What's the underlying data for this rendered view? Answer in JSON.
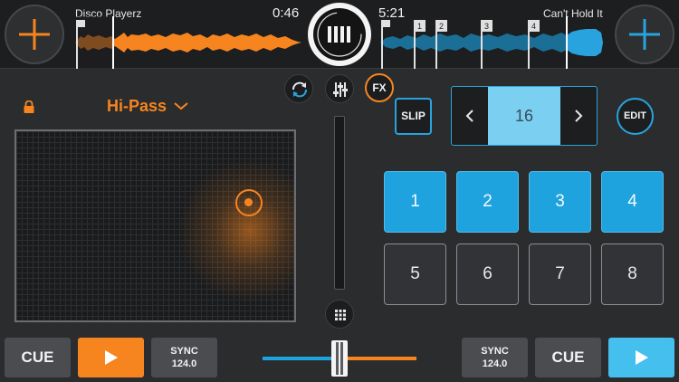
{
  "decks": {
    "left": {
      "track_title": "Disco Playerz",
      "time": "0:46",
      "accent_color": "#f7851f",
      "play_position": 0.12,
      "cue_label": "CUE",
      "sync_label": "SYNC",
      "bpm": "124.0",
      "play_icon": "play-icon"
    },
    "right": {
      "track_title": "Can't Hold It",
      "time": "5:21",
      "accent_color": "#29a3dd",
      "play_position": 0.84,
      "cue_label": "CUE",
      "sync_label": "SYNC",
      "bpm": "124.0",
      "play_icon": "play-icon",
      "hot_cue_markers": [
        "1",
        "2",
        "3",
        "4"
      ]
    }
  },
  "center_controls": {
    "logo_icon": "cross-dj-logo-icon",
    "loop_sync_icon": "loop-arrows-icon",
    "mixer_icon": "sliders-icon",
    "fx_label": "FX",
    "pads_icon": "grid-icon"
  },
  "fx_panel": {
    "lock_icon": "lock-icon",
    "effect_name": "Hi-Pass",
    "dropdown_icon": "chevron-down-icon"
  },
  "loop": {
    "slip_label": "SLIP",
    "prev_icon": "chevron-left-icon",
    "value": "16",
    "next_icon": "chevron-right-icon",
    "edit_label": "EDIT"
  },
  "pads": [
    {
      "label": "1",
      "active": true
    },
    {
      "label": "2",
      "active": true
    },
    {
      "label": "3",
      "active": true
    },
    {
      "label": "4",
      "active": true
    },
    {
      "label": "5",
      "active": false
    },
    {
      "label": "6",
      "active": false
    },
    {
      "label": "7",
      "active": false
    },
    {
      "label": "8",
      "active": false
    }
  ],
  "crossfader": {
    "position": 0.5,
    "left_color": "#1ea3de",
    "right_color": "#f7851f"
  }
}
